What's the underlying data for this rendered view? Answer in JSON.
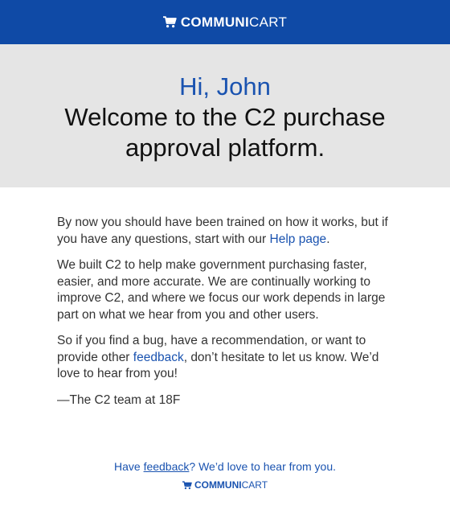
{
  "header": {
    "logo_bold": "COMMUNI",
    "logo_light": "CART",
    "icon": "shopping-cart-icon"
  },
  "hero": {
    "greeting": "Hi, John",
    "headline": "Welcome to the C2 purchase approval platform."
  },
  "body": {
    "p1_before": "By now you should have been trained on how it works, but if you have any questions, start with our ",
    "p1_link": "Help page",
    "p1_after": ".",
    "p2": "We built C2 to help make government purchasing faster, easier, and more accurate. We are continually working to improve C2, and where we focus our work depends in large part on what we hear from you and other users.",
    "p3_before": "So if you find a bug, have a recommendation, or want to provide other ",
    "p3_link": "feedback",
    "p3_after": ", don’t hesitate to let us know. We’d love to hear from you!",
    "signature": "—The C2 team at 18F"
  },
  "footer": {
    "before": "Have ",
    "link": "feedback",
    "after": "? We’d love to hear from you.",
    "logo_bold": "COMMUNI",
    "logo_light": "CART"
  },
  "colors": {
    "brand_blue": "#0f4aa6",
    "link_blue": "#1a53b0",
    "hero_bg": "#e5e5e5"
  }
}
